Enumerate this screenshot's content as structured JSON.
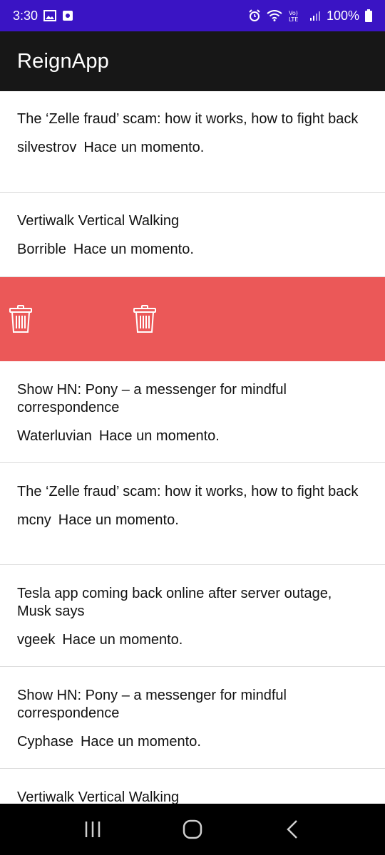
{
  "status_bar": {
    "time": "3:30",
    "battery": "100%",
    "icons": [
      "image-icon",
      "notification-icon",
      "alarm-icon",
      "wifi-icon",
      "volte-icon",
      "signal-icon",
      "battery-icon"
    ]
  },
  "app_bar": {
    "title": "ReignApp"
  },
  "posts": [
    {
      "title": "The ‘Zelle fraud’ scam: how it works, how to fight back",
      "author": "silvestrov",
      "time": "Hace un momento."
    },
    {
      "title": "Vertiwalk Vertical Walking",
      "author": "Borrible",
      "time": "Hace un momento."
    },
    {
      "title": "Show HN: Pony – a messenger for mindful correspondence",
      "author": "Waterluvian",
      "time": "Hace un momento."
    },
    {
      "title": "The ‘Zelle fraud’ scam: how it works, how to fight back",
      "author": "mcny",
      "time": "Hace un momento."
    },
    {
      "title": "Tesla app coming back online after server outage, Musk says",
      "author": "vgeek",
      "time": "Hace un momento."
    },
    {
      "title": "Show HN: Pony – a messenger for mindful correspondence",
      "author": "Cyphase",
      "time": "Hace un momento."
    },
    {
      "title": "Vertiwalk Vertical Walking",
      "author": "",
      "time": ""
    }
  ],
  "swipe_delete": {
    "background": "#eb5858",
    "icon": "trash-icon"
  },
  "colors": {
    "status_bar": "#3a14c4",
    "app_bar": "#171717",
    "delete": "#eb5858"
  },
  "nav_bar": {
    "buttons": [
      "recent-apps-icon",
      "home-icon",
      "back-icon"
    ]
  }
}
